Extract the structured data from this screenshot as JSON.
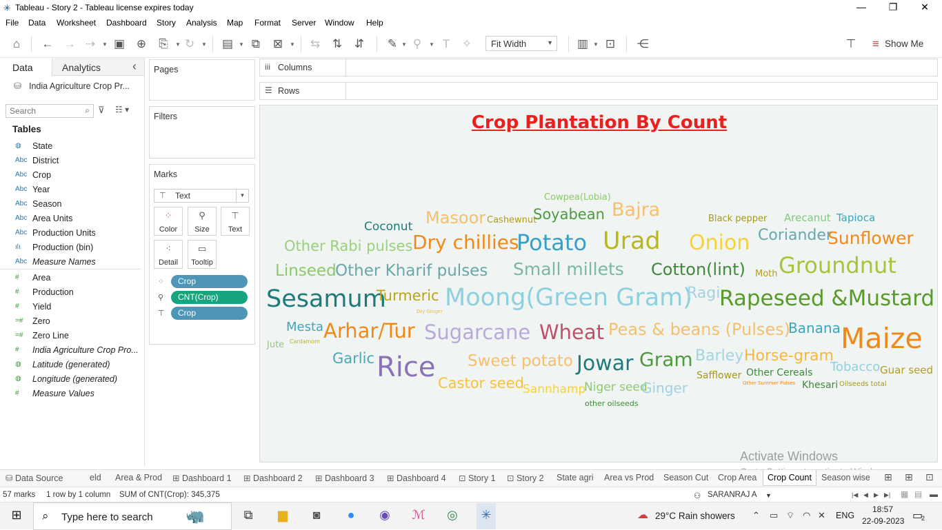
{
  "window": {
    "title": "Tableau - Story 2 - Tableau license expires today",
    "minimize": "—",
    "restore": "❐",
    "close": "✕"
  },
  "menu": [
    "File",
    "Data",
    "Worksheet",
    "Dashboard",
    "Story",
    "Analysis",
    "Map",
    "Format",
    "Server",
    "Window",
    "Help"
  ],
  "toolbar": {
    "fit": "Fit Width",
    "show_me": "Show Me"
  },
  "datapane": {
    "tabs": [
      "Data",
      "Analytics"
    ],
    "collapse": "‹",
    "datasource": "India Agriculture Crop Pr...",
    "search_placeholder": "Search",
    "tables_heading": "Tables",
    "fields": [
      {
        "icon": "globe",
        "label": "State",
        "italic": false
      },
      {
        "icon": "Abc",
        "label": "District",
        "italic": false
      },
      {
        "icon": "Abc",
        "label": "Crop",
        "italic": false
      },
      {
        "icon": "Abc",
        "label": "Year",
        "italic": false
      },
      {
        "icon": "Abc",
        "label": "Season",
        "italic": false
      },
      {
        "icon": "Abc",
        "label": "Area Units",
        "italic": false
      },
      {
        "icon": "Abc",
        "label": "Production Units",
        "italic": false
      },
      {
        "icon": "bin",
        "label": "Production (bin)",
        "italic": false
      },
      {
        "icon": "Abc",
        "label": "Measure Names",
        "italic": true
      },
      {
        "icon": "#",
        "label": "Area",
        "italic": false
      },
      {
        "icon": "#",
        "label": "Production",
        "italic": false
      },
      {
        "icon": "#",
        "label": "Yield",
        "italic": false
      },
      {
        "icon": "calc#",
        "label": "Zero",
        "italic": false
      },
      {
        "icon": "calc#",
        "label": "Zero Line",
        "italic": false
      },
      {
        "icon": "#",
        "label": "India Agriculture Crop Pro...",
        "italic": true
      },
      {
        "icon": "globe",
        "label": "Latitude (generated)",
        "italic": true
      },
      {
        "icon": "globe",
        "label": "Longitude (generated)",
        "italic": true
      },
      {
        "icon": "#",
        "label": "Measure Values",
        "italic": true
      }
    ]
  },
  "cards": {
    "pages": "Pages",
    "filters": "Filters",
    "marks": "Marks",
    "mark_type": "Text",
    "mark_buttons": [
      "Color",
      "Size",
      "Text",
      "Detail",
      "Tooltip"
    ],
    "pills": [
      {
        "icon": "color",
        "label": "Crop",
        "color": "#4e96b8"
      },
      {
        "icon": "size",
        "label": "CNT(Crop)",
        "color": "#16a57c"
      },
      {
        "icon": "text",
        "label": "Crop",
        "color": "#4e96b8"
      }
    ]
  },
  "shelves": {
    "columns": "Columns",
    "rows": "Rows"
  },
  "viz": {
    "title": "Crop Plantation By Count",
    "words": [
      {
        "text": "Cowpea(Lobia)",
        "color": "#8cc96b"
      },
      {
        "text": "Masoor",
        "color": "#f5c06e"
      },
      {
        "text": "Cashewnut",
        "color": "#b59c1e"
      },
      {
        "text": "Soyabean",
        "color": "#4e9a3c"
      },
      {
        "text": "Bajra",
        "color": "#f5c06e"
      },
      {
        "text": "Black pepper",
        "color": "#a59a1a"
      },
      {
        "text": "Arecanut",
        "color": "#7cc97a"
      },
      {
        "text": "Tapioca",
        "color": "#3aa7b8"
      },
      {
        "text": "Coconut",
        "color": "#1f7a7a"
      },
      {
        "text": "Other Rabi pulses",
        "color": "#9ad07a"
      },
      {
        "text": "Dry chillies",
        "color": "#ef8a1a"
      },
      {
        "text": "Potato",
        "color": "#3a9fc4"
      },
      {
        "text": "Urad",
        "color": "#b8b81a"
      },
      {
        "text": "Onion",
        "color": "#f5d23a"
      },
      {
        "text": "Coriander",
        "color": "#6aa8a8"
      },
      {
        "text": "Sunflower",
        "color": "#ef8a1a"
      },
      {
        "text": "Linseed",
        "color": "#8cc96b"
      },
      {
        "text": "Other Kharif pulses",
        "color": "#6aa8a8"
      },
      {
        "text": "Small millets",
        "color": "#79b9a0"
      },
      {
        "text": "Cotton(lint)",
        "color": "#3f8a3a"
      },
      {
        "text": "Moth",
        "color": "#b59c1e"
      },
      {
        "text": "Groundnut",
        "color": "#a7c43a"
      },
      {
        "text": "Sesamum",
        "color": "#1f7a7a"
      },
      {
        "text": "Turmeric",
        "color": "#b8a51a"
      },
      {
        "text": "Moong(Green Gram)",
        "color": "#8fd0de"
      },
      {
        "text": "Ragi",
        "color": "#a3d3e0"
      },
      {
        "text": "Rapeseed &Mustard",
        "color": "#5a9a2a"
      },
      {
        "text": "Dry Ginger",
        "color": "#e8b84a"
      },
      {
        "text": "Mesta",
        "color": "#3aa7b8"
      },
      {
        "text": "Arhar/Tur",
        "color": "#ef8a1a"
      },
      {
        "text": "Sugarcane",
        "color": "#b8a9d8"
      },
      {
        "text": "Wheat",
        "color": "#c0506a"
      },
      {
        "text": "Peas & beans (Pulses)",
        "color": "#f5c06e"
      },
      {
        "text": "Banana",
        "color": "#3aa7b8"
      },
      {
        "text": "Maize",
        "color": "#ef8a1a"
      },
      {
        "text": "Jute",
        "color": "#9ac48a"
      },
      {
        "text": "Cardamom",
        "color": "#b8b81a"
      },
      {
        "text": "Garlic",
        "color": "#4aa8b8"
      },
      {
        "text": "Rice",
        "color": "#8a72b8"
      },
      {
        "text": "Sweet potato",
        "color": "#f5c06e"
      },
      {
        "text": "Jowar",
        "color": "#1f7a7a"
      },
      {
        "text": "Gram",
        "color": "#4e9a3c"
      },
      {
        "text": "Barley",
        "color": "#a3d3e0"
      },
      {
        "text": "Horse-gram",
        "color": "#f5b83a"
      },
      {
        "text": "Tobacco",
        "color": "#8fd0de"
      },
      {
        "text": "Guar seed",
        "color": "#b59c1e"
      },
      {
        "text": "Castor seed",
        "color": "#f5c23a"
      },
      {
        "text": "Sannhamp",
        "color": "#f5d23a"
      },
      {
        "text": "Niger seed",
        "color": "#8cc96b"
      },
      {
        "text": "Ginger",
        "color": "#a3d3e0"
      },
      {
        "text": "Safflower",
        "color": "#a59a1a"
      },
      {
        "text": "Other Cereals",
        "color": "#3f8a3a"
      },
      {
        "text": "Other Summer Pulses",
        "color": "#ef8a1a"
      },
      {
        "text": "Khesari",
        "color": "#3f8a3a"
      },
      {
        "text": "Oilseeds total",
        "color": "#a59a1a"
      },
      {
        "text": "other oilseeds",
        "color": "#3f8a3a"
      }
    ]
  },
  "sheet_tabs": [
    {
      "label": "Data Source",
      "icon": "db"
    },
    {
      "label": "eld",
      "icon": ""
    },
    {
      "label": "Area & Prod",
      "icon": ""
    },
    {
      "label": "Dashboard 1",
      "icon": "dash"
    },
    {
      "label": "Dashboard 2",
      "icon": "dash"
    },
    {
      "label": "Dashboard 3",
      "icon": "dash"
    },
    {
      "label": "Dashboard 4",
      "icon": "dash"
    },
    {
      "label": "Story 1",
      "icon": "story"
    },
    {
      "label": "Story 2",
      "icon": "story"
    },
    {
      "label": "State agri",
      "icon": ""
    },
    {
      "label": "Area vs Prod",
      "icon": ""
    },
    {
      "label": "Season Cut",
      "icon": ""
    },
    {
      "label": "Crop Area",
      "icon": ""
    },
    {
      "label": "Crop Count",
      "icon": ""
    },
    {
      "label": "Season wise",
      "icon": ""
    }
  ],
  "status": {
    "marks": "57 marks",
    "rows": "1 row by 1 column",
    "sum": "SUM of CNT(Crop): 345,375",
    "user": "SARANRAJ A"
  },
  "watermark": {
    "line1": "Activate Windows",
    "line2": "Go to Settings to activate Windows."
  },
  "taskbar": {
    "search": "Type here to search",
    "weather": "29°C  Rain showers",
    "lang": "ENG",
    "time": "18:57",
    "date": "22-09-2023",
    "notif": "2"
  }
}
